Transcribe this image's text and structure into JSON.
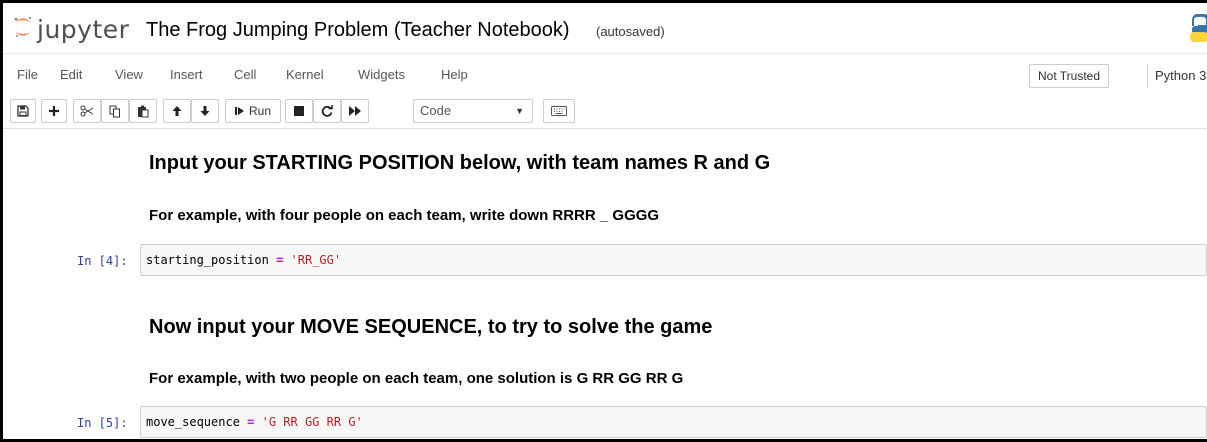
{
  "header": {
    "logo_text": "jupyter",
    "notebook_title": "The Frog Jumping Problem (Teacher Notebook)",
    "autosave_status": "(autosaved)"
  },
  "menubar": {
    "items": [
      "File",
      "Edit",
      "View",
      "Insert",
      "Cell",
      "Kernel",
      "Widgets",
      "Help"
    ],
    "trusted_label": "Not Trusted",
    "kernel_name": "Python 3"
  },
  "toolbar": {
    "run_label": "Run",
    "cell_type": "Code"
  },
  "cells": [
    {
      "type": "markdown",
      "heading": "Input your STARTING POSITION below, with team names R and G"
    },
    {
      "type": "markdown",
      "subheading": "For example, with four people on each team, write down RRRR _ GGGG"
    },
    {
      "type": "code",
      "prompt": "In [4]:",
      "variable": "starting_position",
      "operator": "=",
      "value": "'RR_GG'"
    },
    {
      "type": "markdown",
      "heading": "Now input your MOVE SEQUENCE, to try to solve the game"
    },
    {
      "type": "markdown",
      "subheading": "For example, with two people on each team, one solution is G RR GG RR G"
    },
    {
      "type": "code",
      "prompt": "In [5]:",
      "variable": "move_sequence",
      "operator": "=",
      "value": "'G RR GG RR G'"
    }
  ],
  "colors": {
    "prompt": "#303f9f",
    "string": "#ba2121",
    "operator": "#aa22ff",
    "jupyter_orange": "#f37726"
  }
}
